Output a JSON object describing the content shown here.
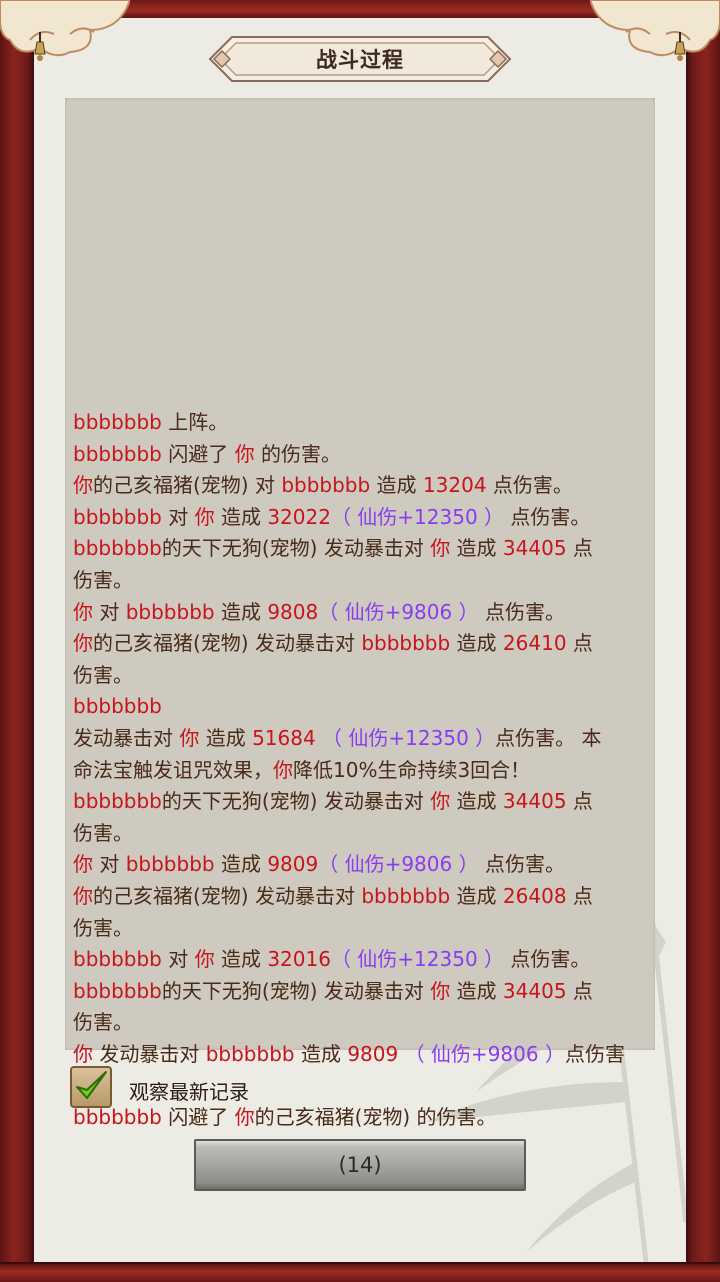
{
  "window": {
    "title": "战斗过程"
  },
  "log_lines": [
    [
      [
        "r",
        "bbbbbbb"
      ],
      [
        "d",
        " 上阵。"
      ]
    ],
    [
      [
        "r",
        "bbbbbbb"
      ],
      [
        "d",
        " 闪避了 "
      ],
      [
        "r",
        "你"
      ],
      [
        "d",
        " 的伤害。"
      ]
    ],
    [
      [
        "r",
        "你"
      ],
      [
        "d",
        "的己亥福猪(宠物) 对 "
      ],
      [
        "r",
        "bbbbbbb"
      ],
      [
        "d",
        " 造成 "
      ],
      [
        "r",
        "13204"
      ],
      [
        "d",
        " 点伤害。"
      ]
    ],
    [
      [
        "r",
        "bbbbbbb"
      ],
      [
        "d",
        " 对 "
      ],
      [
        "r",
        "你"
      ],
      [
        "d",
        " 造成 "
      ],
      [
        "r",
        "32022"
      ],
      [
        "p",
        "（ 仙伤+12350 ）"
      ],
      [
        "d",
        " 点伤害。"
      ]
    ],
    [
      [
        "r",
        "bbbbbbb"
      ],
      [
        "d",
        "的天下无狗(宠物) 发动暴击对 "
      ],
      [
        "r",
        "你"
      ],
      [
        "d",
        " 造成 "
      ],
      [
        "r",
        "34405"
      ],
      [
        "d",
        " 点"
      ]
    ],
    [
      [
        "d",
        "伤害。"
      ]
    ],
    [
      [
        "r",
        "你"
      ],
      [
        "d",
        " 对 "
      ],
      [
        "r",
        "bbbbbbb"
      ],
      [
        "d",
        " 造成 "
      ],
      [
        "r",
        "9808"
      ],
      [
        "p",
        "（ 仙伤+9806 ）"
      ],
      [
        "d",
        " 点伤害。"
      ]
    ],
    [
      [
        "r",
        "你"
      ],
      [
        "d",
        "的己亥福猪(宠物) 发动暴击对 "
      ],
      [
        "r",
        "bbbbbbb"
      ],
      [
        "d",
        " 造成 "
      ],
      [
        "r",
        "26410"
      ],
      [
        "d",
        " 点"
      ]
    ],
    [
      [
        "d",
        "伤害。"
      ]
    ],
    [
      [
        "r",
        "bbbbbbb"
      ]
    ],
    [
      [
        "d",
        "发动暴击对 "
      ],
      [
        "r",
        "你"
      ],
      [
        "d",
        " 造成 "
      ],
      [
        "r",
        "51684"
      ],
      [
        "p",
        " （ 仙伤+12350 ）"
      ],
      [
        "d",
        "点伤害。 本"
      ]
    ],
    [
      [
        "d",
        "命法宝触发诅咒效果，"
      ],
      [
        "r",
        "你"
      ],
      [
        "d",
        "降低10%生命持续3回合！"
      ]
    ],
    [
      [
        "r",
        "bbbbbbb"
      ],
      [
        "d",
        "的天下无狗(宠物) 发动暴击对 "
      ],
      [
        "r",
        "你"
      ],
      [
        "d",
        " 造成 "
      ],
      [
        "r",
        "34405"
      ],
      [
        "d",
        " 点"
      ]
    ],
    [
      [
        "d",
        "伤害。"
      ]
    ],
    [
      [
        "r",
        "你"
      ],
      [
        "d",
        " 对 "
      ],
      [
        "r",
        "bbbbbbb"
      ],
      [
        "d",
        " 造成 "
      ],
      [
        "r",
        "9809"
      ],
      [
        "p",
        "（ 仙伤+9806 ）"
      ],
      [
        "d",
        " 点伤害。"
      ]
    ],
    [
      [
        "r",
        "你"
      ],
      [
        "d",
        "的己亥福猪(宠物) 发动暴击对 "
      ],
      [
        "r",
        "bbbbbbb"
      ],
      [
        "d",
        " 造成 "
      ],
      [
        "r",
        "26408"
      ],
      [
        "d",
        " 点"
      ]
    ],
    [
      [
        "d",
        "伤害。"
      ]
    ],
    [
      [
        "r",
        "bbbbbbb"
      ],
      [
        "d",
        " 对 "
      ],
      [
        "r",
        "你"
      ],
      [
        "d",
        " 造成 "
      ],
      [
        "r",
        "32016"
      ],
      [
        "p",
        "（ 仙伤+12350 ）"
      ],
      [
        "d",
        " 点伤害。"
      ]
    ],
    [
      [
        "r",
        "bbbbbbb"
      ],
      [
        "d",
        "的天下无狗(宠物) 发动暴击对 "
      ],
      [
        "r",
        "你"
      ],
      [
        "d",
        " 造成 "
      ],
      [
        "r",
        "34405"
      ],
      [
        "d",
        " 点"
      ]
    ],
    [
      [
        "d",
        "伤害。"
      ]
    ],
    [
      [
        "r",
        "你"
      ],
      [
        "d",
        " 发动暴击对 "
      ],
      [
        "r",
        "bbbbbbb"
      ],
      [
        "d",
        " 造成 "
      ],
      [
        "r",
        "9809"
      ],
      [
        "p",
        " （ 仙伤+9806 ）"
      ],
      [
        "d",
        "点伤害"
      ]
    ],
    [
      [
        "d",
        "。"
      ]
    ],
    [
      [
        "r",
        "bbbbbbb"
      ],
      [
        "d",
        " 闪避了 "
      ],
      [
        "r",
        "你"
      ],
      [
        "d",
        "的己亥福猪(宠物) 的伤害。"
      ]
    ]
  ],
  "checkbox": {
    "label": "观察最新记录",
    "checked": true
  },
  "count_button": {
    "label": "(14)"
  },
  "colors": {
    "actor_red": "#c8141a",
    "bonus_purple": "#8a3cf0",
    "text_dark": "#4a2a18",
    "frame_red": "#8a2420",
    "paper": "#ecebe4",
    "log_bg": "#cfcac0",
    "check_green": "#6fd41a"
  }
}
